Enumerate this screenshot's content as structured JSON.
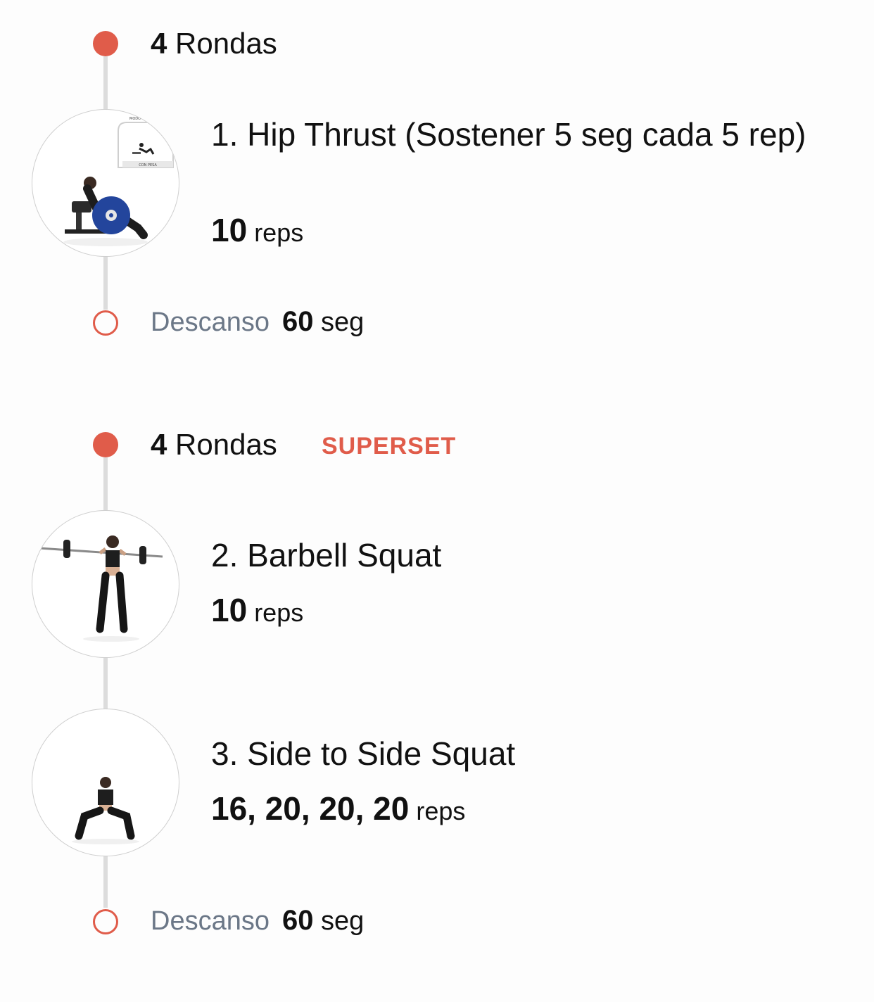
{
  "colors": {
    "accent": "#e05c4a",
    "rest_label": "#6b7787"
  },
  "group1": {
    "rounds_num": "4",
    "rounds_label": "Rondas",
    "exercise": {
      "title": "1. Hip Thrust (Sostener 5 seg cada 5 rep)",
      "reps_value": "10",
      "reps_unit": "reps",
      "thumb_inset_top": "MODO",
      "thumb_inset_caption": "CON PESA"
    },
    "rest": {
      "label": "Descanso",
      "value_num": "60",
      "value_unit": "seg"
    }
  },
  "group2": {
    "rounds_num": "4",
    "rounds_label": "Rondas",
    "badge": "SUPERSET",
    "exercises": [
      {
        "title": "2. Barbell Squat",
        "reps_value": "10",
        "reps_unit": "reps"
      },
      {
        "title": "3. Side to Side Squat",
        "reps_value": "16, 20, 20, 20",
        "reps_unit": "reps"
      }
    ],
    "rest": {
      "label": "Descanso",
      "value_num": "60",
      "value_unit": "seg"
    }
  }
}
